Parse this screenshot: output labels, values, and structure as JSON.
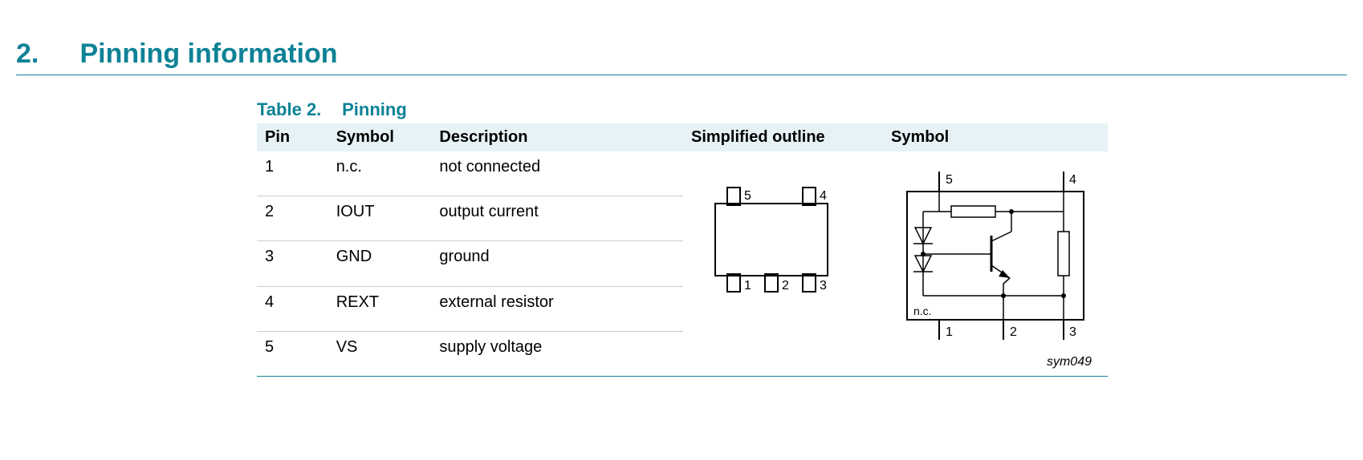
{
  "section": {
    "number": "2.",
    "title": "Pinning information"
  },
  "table": {
    "caption_label": "Table 2.",
    "caption_title": "Pinning",
    "headers": {
      "pin": "Pin",
      "symbol": "Symbol",
      "description": "Description",
      "outline": "Simplified outline",
      "symbol2": "Symbol"
    },
    "rows": [
      {
        "pin": "1",
        "symbol": "n.c.",
        "description": "not connected"
      },
      {
        "pin": "2",
        "symbol": "IOUT",
        "description": "output current"
      },
      {
        "pin": "3",
        "symbol": "GND",
        "description": "ground"
      },
      {
        "pin": "4",
        "symbol": "REXT",
        "description": "external resistor"
      },
      {
        "pin": "5",
        "symbol": "VS",
        "description": "supply voltage"
      }
    ]
  },
  "outline": {
    "pin_top_left": "5",
    "pin_top_right": "4",
    "pin_bottom_left": "1",
    "pin_bottom_center": "2",
    "pin_bottom_right": "3"
  },
  "symbol_diagram": {
    "pin_top_left": "5",
    "pin_top_right": "4",
    "pin_bottom_left": "1",
    "pin_bottom_center": "2",
    "pin_bottom_right": "3",
    "nc_label": "n.c.",
    "ref": "sym049"
  }
}
